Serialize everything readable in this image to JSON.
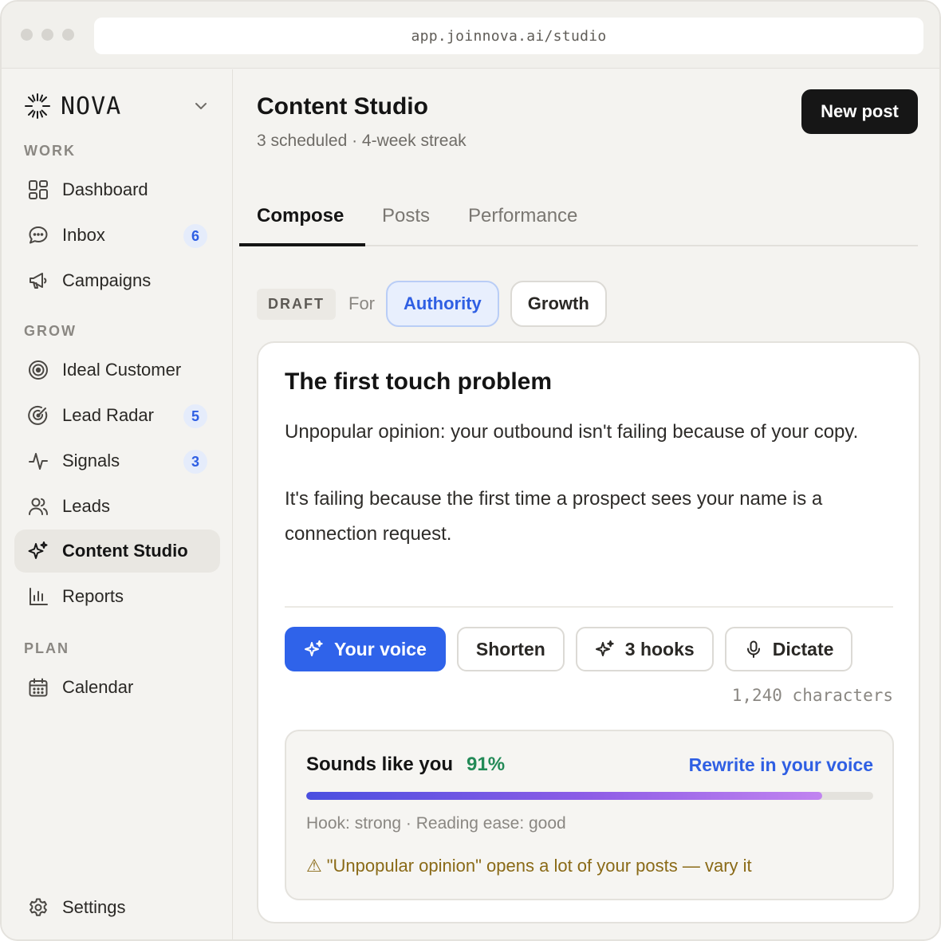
{
  "browser": {
    "url": "app.joinnova.ai/studio"
  },
  "brand": {
    "name": "NOVA",
    "logo_icon": "starburst-icon",
    "menu_icon": "chevron-down-icon"
  },
  "sidebar": {
    "sections": [
      {
        "label": "WORK"
      },
      {
        "label": "GROW"
      },
      {
        "label": "PLAN"
      }
    ],
    "items": [
      {
        "label": "Dashboard",
        "icon": "dashboard-icon"
      },
      {
        "label": "Inbox",
        "icon": "chat-icon",
        "badge": "6"
      },
      {
        "label": "Campaigns",
        "icon": "megaphone-icon"
      },
      {
        "label": "Ideal Customer",
        "icon": "target-icon"
      },
      {
        "label": "Lead Radar",
        "icon": "radar-icon",
        "badge": "5"
      },
      {
        "label": "Signals",
        "icon": "pulse-icon",
        "badge": "3"
      },
      {
        "label": "Leads",
        "icon": "users-icon"
      },
      {
        "label": "Content Studio",
        "icon": "sparkle-icon",
        "active": true
      },
      {
        "label": "Reports",
        "icon": "bar-chart-icon"
      },
      {
        "label": "Calendar",
        "icon": "calendar-icon"
      }
    ],
    "settings": {
      "label": "Settings",
      "icon": "gear-icon"
    }
  },
  "header": {
    "title": "Content Studio",
    "subtitle": "3 scheduled · 4-week streak",
    "new_post_label": "New post"
  },
  "tabs": [
    {
      "label": "Compose",
      "active": true
    },
    {
      "label": "Posts"
    },
    {
      "label": "Performance"
    }
  ],
  "compose": {
    "status_tag": "DRAFT",
    "for_label": "For",
    "audience_chips": [
      {
        "label": "Authority",
        "selected": true
      },
      {
        "label": "Growth",
        "selected": false
      }
    ],
    "post": {
      "title": "The first touch problem",
      "paragraphs": [
        "Unpopular opinion: your outbound isn't failing because of your copy.",
        "It's failing because the first time a prospect sees your name is a connection request."
      ]
    },
    "actions": [
      {
        "label": "Your voice",
        "icon": "sparkle-icon",
        "primary": true
      },
      {
        "label": "Shorten"
      },
      {
        "label": "3 hooks",
        "icon": "sparkle-icon"
      },
      {
        "label": "Dictate",
        "icon": "microphone-icon"
      }
    ],
    "char_count": "1,240 characters",
    "voice_match": {
      "label": "Sounds like you",
      "percent_text": "91%",
      "percent": 0.91,
      "rewrite_link": "Rewrite in your voice",
      "meta": "Hook: strong · Reading ease: good",
      "warning_icon": "warning-icon",
      "warning_glyph": "⚠",
      "warning": "\"Unpopular opinion\" opens a lot of your posts — vary it"
    }
  },
  "colors": {
    "accent": "#2f63ea",
    "badge_text": "#2f5fe3",
    "success": "#238a57",
    "warning": "#8a6a17"
  }
}
